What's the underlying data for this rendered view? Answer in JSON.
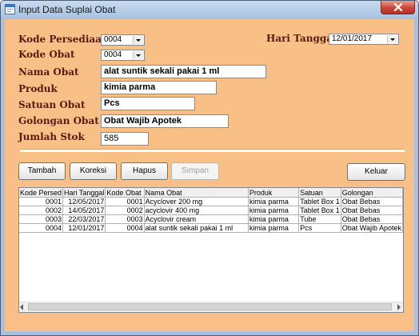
{
  "window": {
    "title": "Input Data Suplai Obat"
  },
  "form": {
    "kode_persediaan": {
      "label": "Kode Persediaan",
      "value": "0004"
    },
    "kode_obat": {
      "label": "Kode Obat",
      "value": "0004"
    },
    "nama_obat": {
      "label": "Nama Obat",
      "value": "alat suntik sekali pakai 1 ml"
    },
    "produk": {
      "label": "Produk",
      "value": "kimia parma"
    },
    "satuan_obat": {
      "label": "Satuan Obat",
      "value": "Pcs"
    },
    "golongan_obat": {
      "label": "Golongan Obat",
      "value": "Obat Wajib Apotek"
    },
    "jumlah_stok": {
      "label": "Jumlah Stok",
      "value": "585"
    },
    "hari_tanggal": {
      "label": "Hari Tanggal",
      "value": "12/01/2017"
    }
  },
  "buttons": {
    "tambah": "Tambah",
    "koreksi": "Koreksi",
    "hapus": "Hapus",
    "simpan": "Simpan",
    "keluar": "Keluar"
  },
  "grid": {
    "columns": [
      "Kode Persed",
      "Hari Tanggal",
      "Kode Obat",
      "Nama Obat",
      "Produk",
      "Satuan",
      "Golongan"
    ],
    "rows": [
      [
        "0001",
        "12/05/2017",
        "0001",
        "Acyclover 200 mg",
        "kimia parma",
        "Tablet Box 1",
        "Obat Bebas"
      ],
      [
        "0002",
        "14/05/2017",
        "0002",
        "acyclovir 400 mg",
        "kimia parma",
        "Tablet Box 1",
        "Obat Bebas"
      ],
      [
        "0003",
        "22/03/2017",
        "0003",
        "Acyclovir cream",
        "kimia parma",
        "Tube",
        "Obat Bebas"
      ],
      [
        "0004",
        "12/01/2017",
        "0004",
        "alat suntik sekali pakai 1 ml",
        "kimia parma",
        "Pcs",
        "Obat Wajib Apotek"
      ]
    ]
  },
  "colors": {
    "client_bg": "#f8bf87",
    "label_text": "#5a1a10",
    "title_bar": "#a9c1df",
    "close_button": "#c9463a"
  },
  "icons": {
    "app": "app-window-icon",
    "close": "close-icon"
  }
}
